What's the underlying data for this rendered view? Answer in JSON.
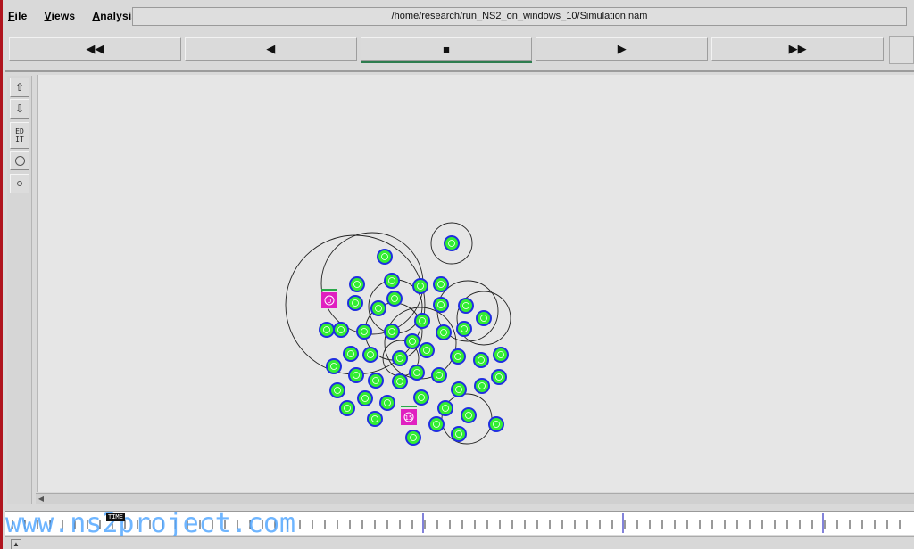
{
  "menu": {
    "file": "File",
    "views": "Views",
    "analysis": "Analysis"
  },
  "window": {
    "title": "/home/research/run_NS2_on_windows_10/Simulation.nam"
  },
  "transport": {
    "rewind": "◀◀",
    "back": "◀",
    "stop": "■",
    "play": "▶",
    "fastforward": "▶▶",
    "active": "stop"
  },
  "tools": {
    "zoom_in": "⇧",
    "zoom_out": "⇩",
    "edit_label": "ED\nIT"
  },
  "timeline": {
    "time_badge": "TIME"
  },
  "watermark": {
    "text": "www.ns2project.com"
  },
  "colors": {
    "node_fill": "#33ee33",
    "node_ring": "#1f2fe0",
    "special_node": "#e020c0",
    "range_circle": "#222222",
    "canvas": "#e6e6e6"
  },
  "nodes": [
    {
      "label": "0",
      "special": true
    },
    {
      "label": "15",
      "special": true
    }
  ]
}
